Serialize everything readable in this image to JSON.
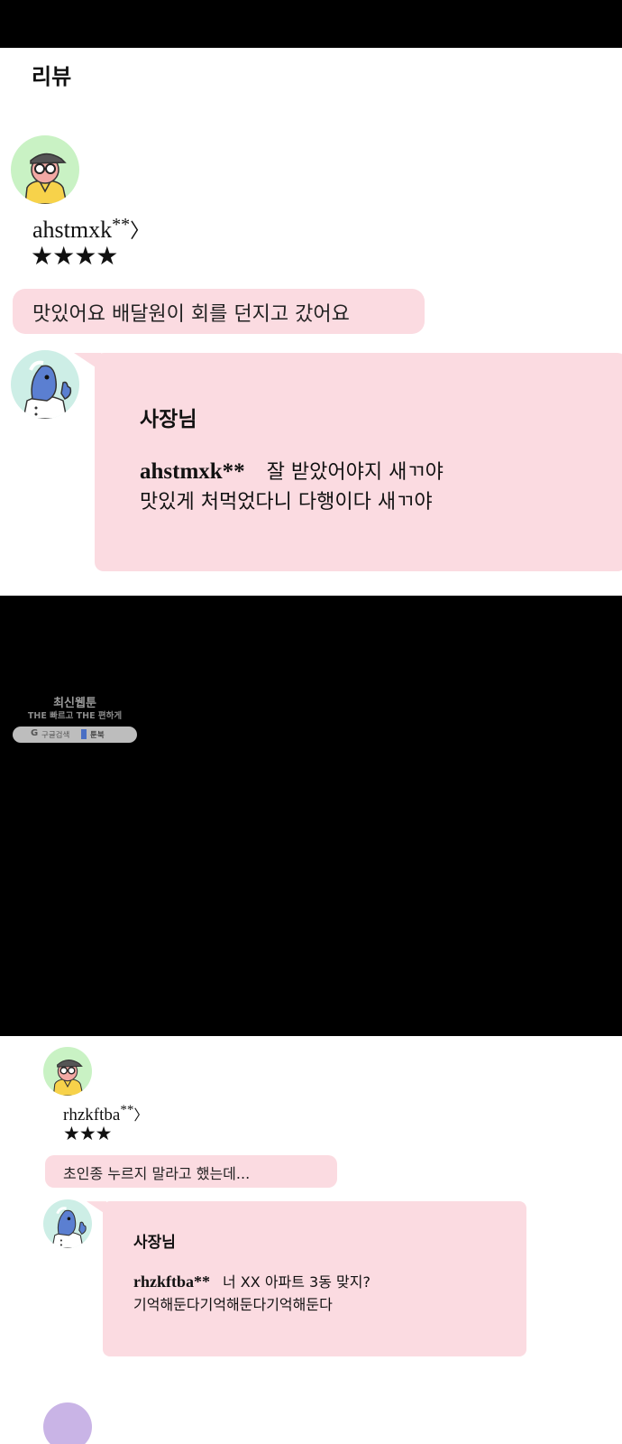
{
  "section_title": "리뷰",
  "reviews": [
    {
      "reviewer": "ahstmxk",
      "masked": "**",
      "arrow": "〉",
      "stars": "★★★★",
      "comment": "맛있어요 배달원이 회를 던지고 갔어요",
      "reply": {
        "owner_label": "사장님",
        "mention": "ahstmxk**",
        "line1": "잘 받았어야지 새ㄲ야",
        "line2": "맛있게 처먹었다니 다행이다 새ㄲ야"
      }
    },
    {
      "reviewer": "rhzkftba",
      "masked": "**",
      "arrow": "〉",
      "stars": "★★★",
      "comment": "초인종 누르지 말라고 했는데...",
      "reply": {
        "owner_label": "사장님",
        "mention": "rhzkftba**",
        "line1": "너 XX 아파트 3동 맞지?",
        "line2": "기억해둔다기억해둔다기억해둔다"
      }
    }
  ],
  "watermark": {
    "line1": "최신웹툰",
    "line2": "THE 빠르고 THE 편하게",
    "search_label": "구글검색",
    "site_label": "툰북"
  },
  "colors": {
    "bubble_pink": "#fbdbe1",
    "customer_avatar_bg": "#c9f2c4",
    "owner_avatar_bg": "#cdeee6",
    "next_avatar_bg": "#c9b4e6"
  }
}
